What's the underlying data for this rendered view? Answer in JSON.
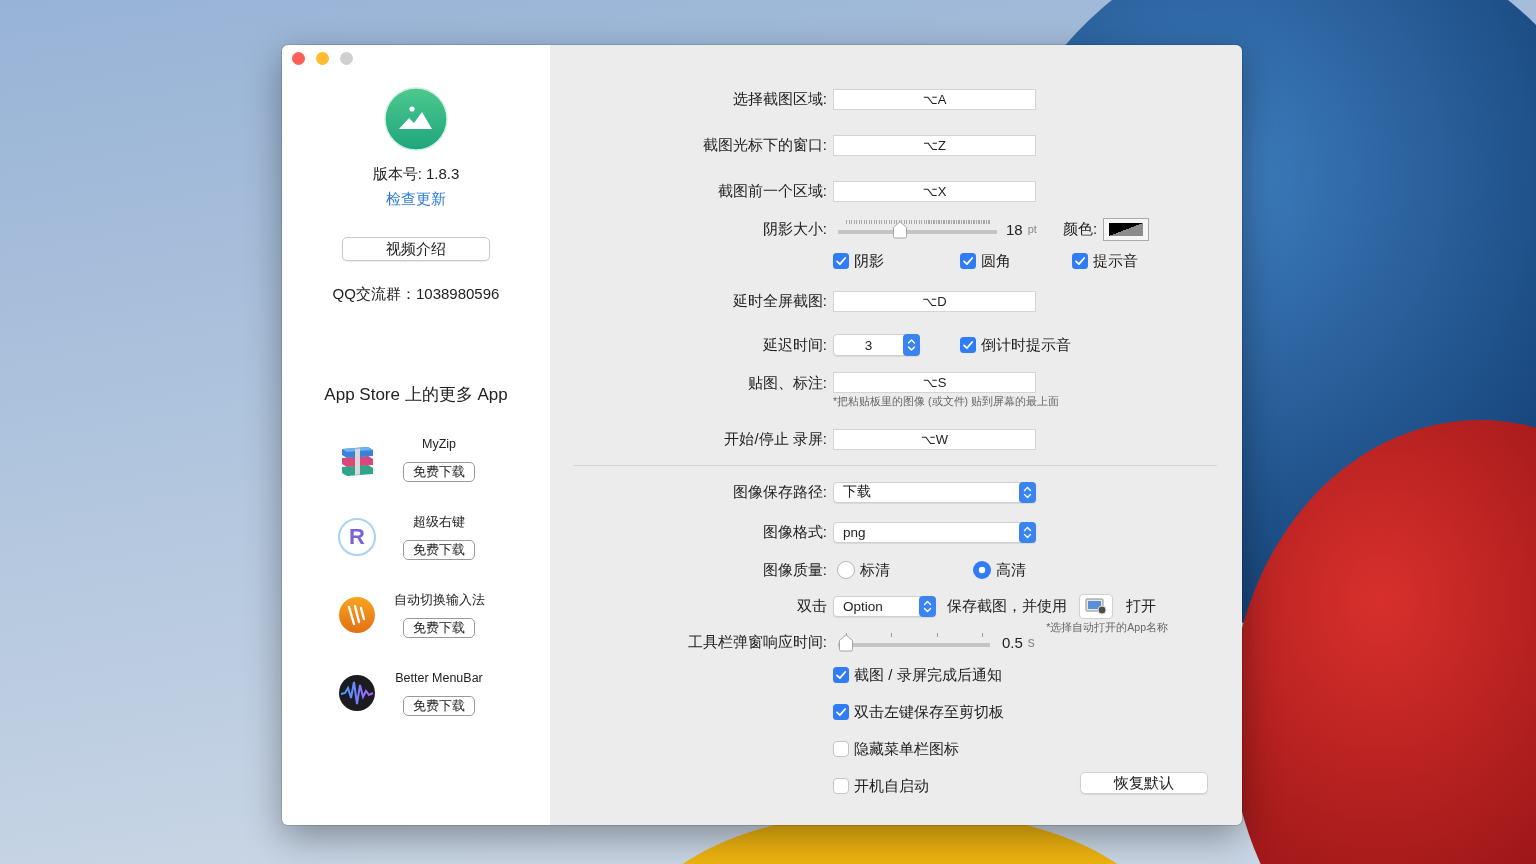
{
  "window": {
    "traffic_lights": [
      {
        "color": "#fe5f57"
      },
      {
        "color": "#febc2e"
      },
      {
        "color": "#cfcfcf"
      }
    ]
  },
  "sidebar": {
    "version": "版本号: 1.8.3",
    "update_link": "检查更新",
    "video_button": "视频介绍",
    "qq_group": "QQ交流群：1038980596",
    "more_apps_title": "App Store 上的更多 App",
    "apps": [
      {
        "kind": "books",
        "name": "MyZip",
        "button": "免费下载"
      },
      {
        "kind": "letter",
        "logo_letter": "R",
        "name": "超级右键",
        "button": "免费下载"
      },
      {
        "kind": "strokes",
        "name": "自动切换输入法",
        "button": "免费下载"
      },
      {
        "kind": "wave",
        "name": "Better MenuBar",
        "button": "免费下载"
      }
    ]
  },
  "settings": {
    "sections": [
      {
        "rows": [
          {
            "kind": "shortcut",
            "label": "选择截图区域:",
            "value": "⌥A"
          },
          {
            "kind": "shortcut",
            "label": "截图光标下的窗口:",
            "value": "⌥Z"
          },
          {
            "kind": "shortcut",
            "label": "截图前一个区域:",
            "value": "⌥X"
          },
          {
            "kind": "shadow",
            "label": "阴影大小:",
            "level": 0.38,
            "reading": "18",
            "unit": "pt",
            "color_label": "颜色:",
            "color": "#000000"
          },
          {
            "kind": "checks",
            "items": [
              {
                "label": "阴影",
                "checked": true
              },
              {
                "label": "圆角",
                "checked": true
              },
              {
                "label": "提示音",
                "checked": true
              }
            ]
          },
          {
            "kind": "shortcut",
            "label": "延时全屏截图:",
            "value": "⌥D"
          },
          {
            "kind": "stepper",
            "label": "延迟时间:",
            "value": "3",
            "check": {
              "label": "倒计时提示音",
              "checked": true
            }
          },
          {
            "kind": "shortcut",
            "label": "贴图、标注:",
            "value": "⌥S",
            "note": "*把粘贴板里的图像 (或文件) 贴到屏幕的最上面"
          },
          {
            "kind": "shortcut",
            "label": "开始/停止 录屏:",
            "value": "⌥W"
          }
        ]
      },
      {
        "rows": [
          {
            "kind": "popup",
            "label": "图像保存路径:",
            "value": "下载"
          },
          {
            "kind": "popup",
            "label": "图像格式:",
            "value": "png"
          },
          {
            "kind": "radio",
            "label": "图像质量:",
            "options": [
              {
                "label": "标清",
                "selected": false
              },
              {
                "label": "高清",
                "selected": true
              }
            ]
          },
          {
            "kind": "double_click",
            "label": "双击",
            "value": "Option",
            "middle_text": "保存截图，并使用",
            "end_text": "打开",
            "note": "*选择自动打开的App名称"
          },
          {
            "kind": "slider",
            "label": "工具栏弹窗响应时间:",
            "level": 0,
            "reading": "0.5",
            "unit": "s"
          }
        ]
      }
    ],
    "options": [
      {
        "label": "截图 / 录屏完成后通知",
        "checked": true
      },
      {
        "label": "双击左键保存至剪切板",
        "checked": true
      },
      {
        "label": "隐藏菜单栏图标",
        "checked": false
      },
      {
        "label": "开机自启动",
        "checked": false
      }
    ],
    "reset_button": "恢复默认"
  }
}
